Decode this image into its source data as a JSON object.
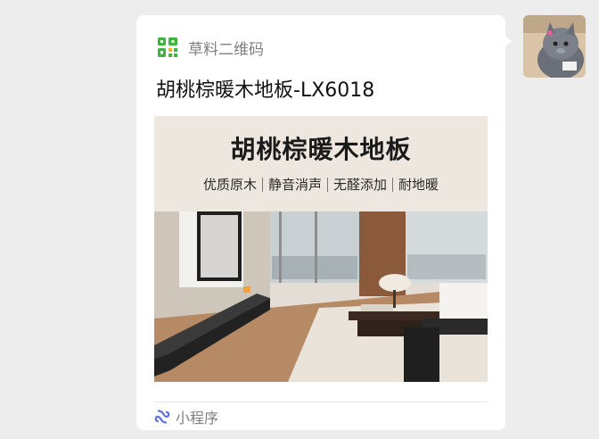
{
  "message": {
    "app_name": "草料二维码",
    "title": "胡桃棕暖木地板-LX6018",
    "banner": {
      "heading": "胡桃棕暖木地板",
      "features": [
        "优质原木",
        "静音消声",
        "无醛添加",
        "耐地暖"
      ]
    },
    "footer_label": "小程序"
  },
  "colors": {
    "background": "#ededed",
    "bubble": "#ffffff",
    "banner_header": "#eee7df",
    "brand_green": "#3fb540",
    "mini_program_blue": "#5f6ee0"
  },
  "icons": {
    "app": "qr-code-icon",
    "footer": "mini-program-icon"
  }
}
